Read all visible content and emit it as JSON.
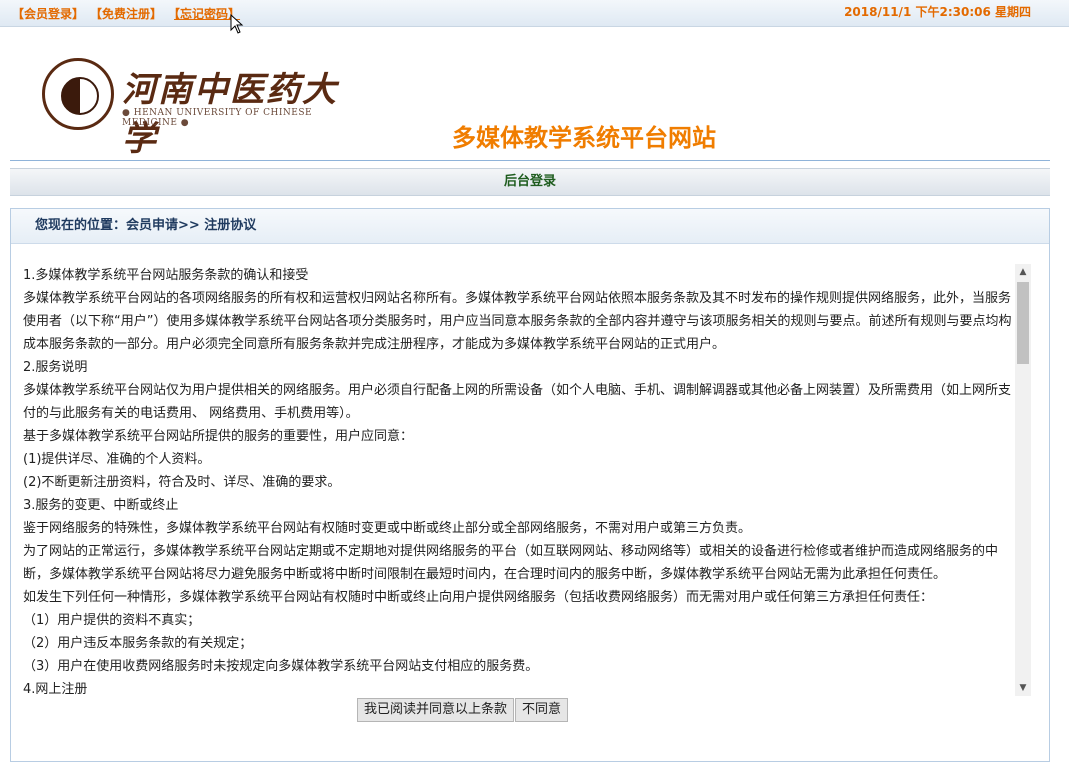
{
  "topbar": {
    "links": [
      "【会员登录】",
      "【免费注册】",
      "【忘记密码】"
    ],
    "datetime": "2018/11/1 下午2:30:06  星期四"
  },
  "header": {
    "logo_cn": "河南中医药大学",
    "logo_en": "● HENAN UNIVERSITY OF CHINESE MEDICINE ●",
    "site_title": "多媒体教学系统平台网站"
  },
  "admin_bar": {
    "label": "后台登录"
  },
  "breadcrumb": {
    "text": "您现在的位置：会员申请>> 注册协议"
  },
  "agreement": {
    "lines": [
      "1.多媒体教学系统平台网站服务条款的确认和接受",
      "多媒体教学系统平台网站的各项网络服务的所有权和运营权归网站名称所有。多媒体教学系统平台网站依照本服务条款及其不时发布的操作规则提供网络服务，此外，当服务使用者（以下称“用户”）使用多媒体教学系统平台网站各项分类服务时，用户应当同意本服务条款的全部内容并遵守与该项服务相关的规则与要点。前述所有规则与要点均构成本服务条款的一部分。用户必须完全同意所有服务条款并完成注册程序，才能成为多媒体教学系统平台网站的正式用户。",
      "2.服务说明",
      "多媒体教学系统平台网站仅为用户提供相关的网络服务。用户必须自行配备上网的所需设备（如个人电脑、手机、调制解调器或其他必备上网装置）及所需费用（如上网所支付的与此服务有关的电话费用、 网络费用、手机费用等）。",
      "基于多媒体教学系统平台网站所提供的服务的重要性，用户应同意：",
      "(1)提供详尽、准确的个人资料。",
      "(2)不断更新注册资料，符合及时、详尽、准确的要求。",
      "3.服务的变更、中断或终止",
      "鉴于网络服务的特殊性，多媒体教学系统平台网站有权随时变更或中断或终止部分或全部网络服务，不需对用户或第三方负责。",
      "为了网站的正常运行，多媒体教学系统平台网站定期或不定期地对提供网络服务的平台（如互联网网站、移动网络等）或相关的设备进行检修或者维护而造成网络服务的中断，多媒体教学系统平台网站将尽力避免服务中断或将中断时间限制在最短时间内，在合理时间内的服务中断，多媒体教学系统平台网站无需为此承担任何责任。",
      "如发生下列任何一种情形，多媒体教学系统平台网站有权随时中断或终止向用户提供网络服务（包括收费网络服务）而无需对用户或任何第三方承担任何责任：",
      "（1）用户提供的资料不真实；",
      "（2）用户违反本服务条款的有关规定；",
      "（3）用户在使用收费网络服务时未按规定向多媒体教学系统平台网站支付相应的服务费。",
      "4.网上注册"
    ]
  },
  "buttons": {
    "agree": "我已阅读并同意以上条款",
    "disagree": "不同意"
  },
  "icons": {
    "scroll_up": "▲",
    "scroll_down": "▼"
  }
}
